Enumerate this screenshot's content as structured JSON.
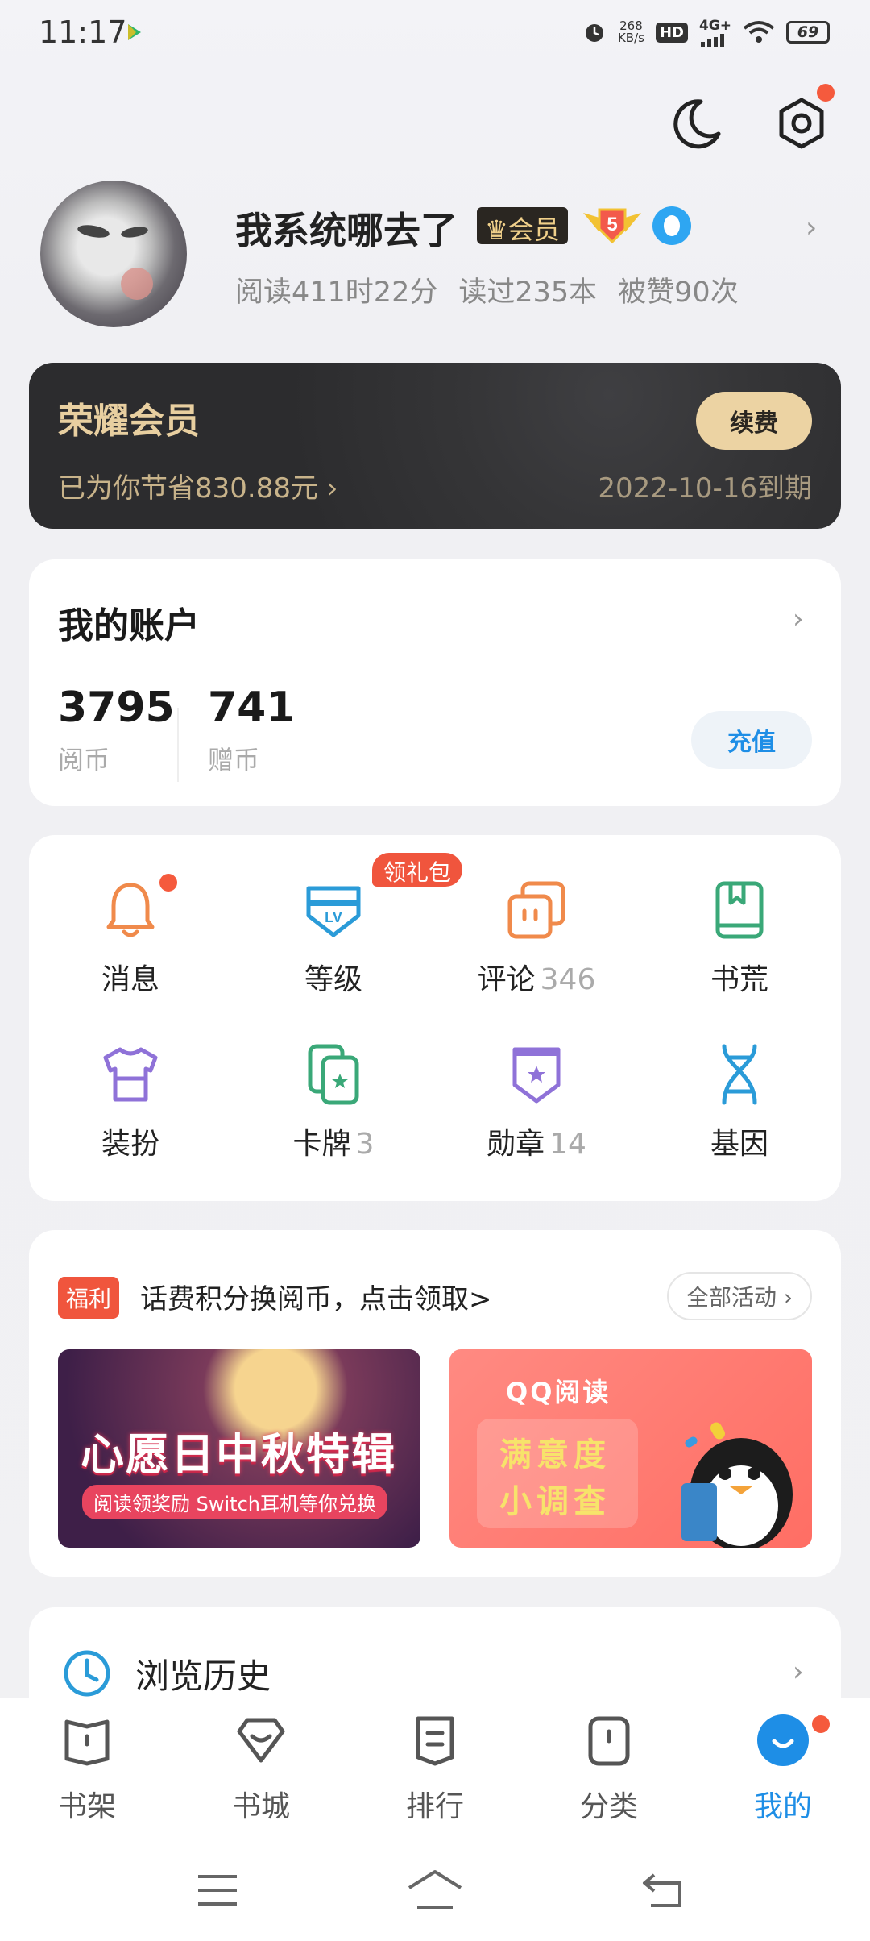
{
  "status_bar": {
    "time": "11:17",
    "net_speed_value": "268",
    "net_speed_unit": "KB/s",
    "hd": "HD",
    "signal": "4G+",
    "battery": "69"
  },
  "profile": {
    "username": "我系统哪去了",
    "vip_badge": "会员",
    "level": "5",
    "stats": [
      "阅读411时22分",
      "读过235本",
      "被赞90次"
    ]
  },
  "honor_card": {
    "title": "荣耀会员",
    "saved": "已为你节省830.88元 ›",
    "renew_label": "续费",
    "expire": "2022-10-16到期"
  },
  "account": {
    "title": "我的账户",
    "coins": [
      {
        "value": "3795",
        "label": "阅币"
      },
      {
        "value": "741",
        "label": "赠币"
      }
    ],
    "recharge_label": "充值"
  },
  "grid": {
    "gift_tag": "领礼包",
    "items": [
      {
        "label": "消息",
        "count": ""
      },
      {
        "label": "等级",
        "count": ""
      },
      {
        "label": "评论",
        "count": "346"
      },
      {
        "label": "书荒",
        "count": ""
      },
      {
        "label": "装扮",
        "count": ""
      },
      {
        "label": "卡牌",
        "count": "3"
      },
      {
        "label": "勋章",
        "count": "14"
      },
      {
        "label": "基因",
        "count": ""
      }
    ]
  },
  "welfare": {
    "tag": "福利",
    "text": "话费积分换阅币，点击领取>",
    "all_label": "全部活动 ›",
    "banner_left": {
      "title": "心愿日中秋特辑",
      "subtitle": "阅读领奖励 Switch耳机等你兑换"
    },
    "banner_right": {
      "head": "QQ阅读",
      "line1": "满意度",
      "line2": "小调查"
    }
  },
  "history": {
    "label": "浏览历史"
  },
  "tabs": [
    {
      "label": "书架",
      "icon": "bookshelf-icon"
    },
    {
      "label": "书城",
      "icon": "bookstore-icon"
    },
    {
      "label": "排行",
      "icon": "ranking-icon"
    },
    {
      "label": "分类",
      "icon": "category-icon"
    },
    {
      "label": "我的",
      "icon": "profile-icon"
    }
  ],
  "colors": {
    "accent": "#1e8ee6",
    "red": "#f0553d",
    "gold": "#e8cfa0"
  }
}
